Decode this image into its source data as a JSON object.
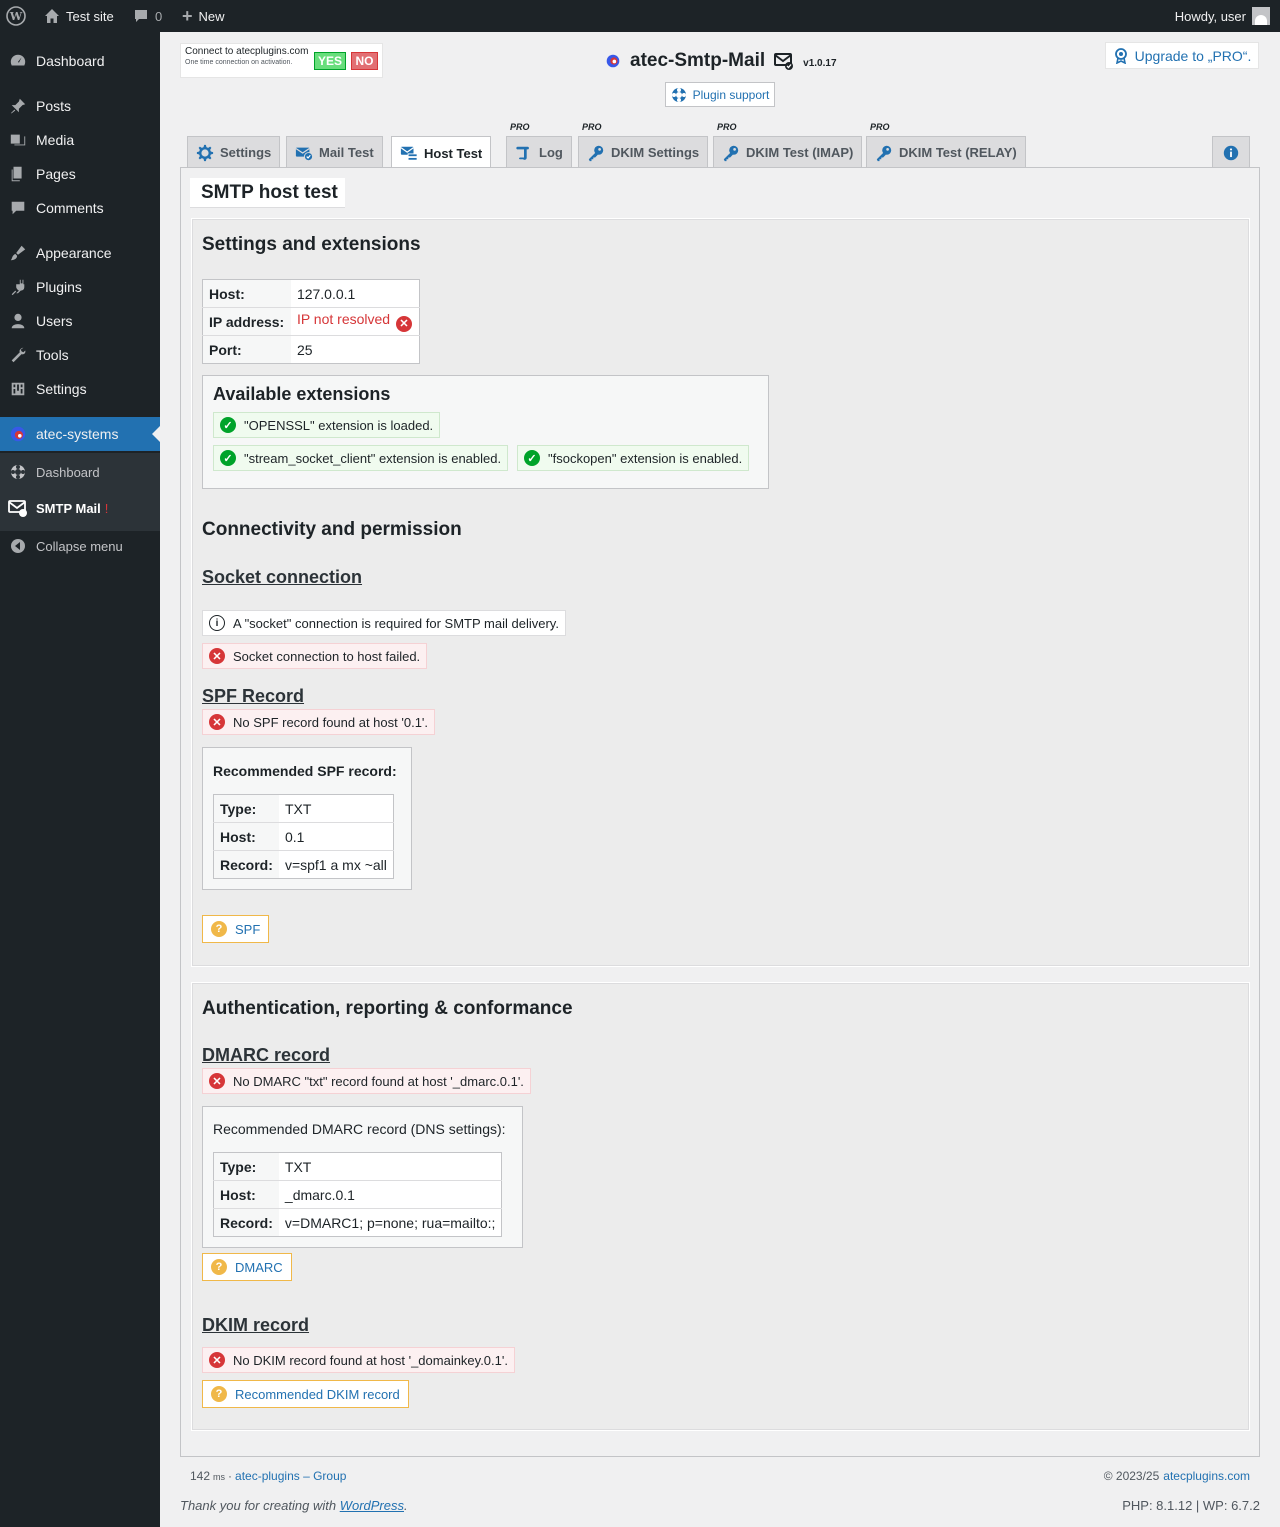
{
  "adminbar": {
    "site_name": "Test site",
    "comments_count": "0",
    "new_label": "New",
    "howdy": "Howdy, user"
  },
  "sidebar": {
    "items": [
      {
        "label": "Dashboard",
        "icon": "dashboard-icon"
      },
      {
        "label": "Posts",
        "icon": "pin-icon"
      },
      {
        "label": "Media",
        "icon": "media-icon"
      },
      {
        "label": "Pages",
        "icon": "pages-icon"
      },
      {
        "label": "Comments",
        "icon": "comments-icon"
      },
      {
        "label": "Appearance",
        "icon": "brush-icon"
      },
      {
        "label": "Plugins",
        "icon": "plug-icon"
      },
      {
        "label": "Users",
        "icon": "users-icon"
      },
      {
        "label": "Tools",
        "icon": "wrench-icon"
      },
      {
        "label": "Settings",
        "icon": "settings-icon"
      },
      {
        "label": "atec-systems",
        "icon": "atec-logo-icon"
      }
    ],
    "submenu": [
      {
        "label": "Dashboard"
      },
      {
        "label": "SMTP Mail",
        "marker": "!"
      }
    ],
    "collapse": "Collapse menu"
  },
  "header": {
    "connect_title": "Connect to atecplugins.com",
    "connect_sub": "One time connection on activation.",
    "yes": "YES",
    "no": "NO",
    "plugin_title": "atec-Smtp-Mail",
    "version": "v1.0.17",
    "plugin_support": "Plugin support",
    "upgrade": "Upgrade to „PRO“."
  },
  "tabs": [
    {
      "label": "Settings",
      "pro": ""
    },
    {
      "label": "Mail Test",
      "pro": ""
    },
    {
      "label": "Host Test",
      "pro": ""
    },
    {
      "label": "Log",
      "pro": "PRO"
    },
    {
      "label": "DKIM Settings",
      "pro": "PRO"
    },
    {
      "label": "DKIM Test (IMAP)",
      "pro": "PRO"
    },
    {
      "label": "DKIM Test (RELAY)",
      "pro": "PRO"
    }
  ],
  "page_title": "SMTP host test",
  "settings": {
    "heading": "Settings and extensions",
    "host_label": "Host:",
    "host_value": "127.0.0.1",
    "ip_label": "IP address:",
    "ip_value": "IP not resolved",
    "port_label": "Port:",
    "port_value": "25",
    "ext_heading": "Available extensions",
    "ext": [
      "\"OPENSSL\" extension is loaded.",
      "\"stream_socket_client\" extension is enabled.",
      "\"fsockopen\" extension is enabled."
    ]
  },
  "connectivity": {
    "heading": "Connectivity and permission",
    "socket_heading": "Socket connection",
    "socket_info": "A \"socket\" connection is required for SMTP mail delivery.",
    "socket_error": "Socket connection to host failed.",
    "spf_heading": "SPF Record",
    "spf_error": "No SPF record found at host '0.1'.",
    "spf_rec_heading": "Recommended SPF record:",
    "spf_type_label": "Type:",
    "spf_type": "TXT",
    "spf_host_label": "Host:",
    "spf_host": "0.1",
    "spf_record_label": "Record:",
    "spf_record": "v=spf1 a mx ~all",
    "spf_help": "SPF"
  },
  "auth": {
    "heading": "Authentication, reporting & conformance",
    "dmarc_heading": "DMARC record",
    "dmarc_error": "No DMARC \"txt\" record found at host '_dmarc.0.1'.",
    "dmarc_rec_heading": "Recommended DMARC record (DNS settings):",
    "dmarc_type_label": "Type:",
    "dmarc_type": "TXT",
    "dmarc_host_label": "Host:",
    "dmarc_host": "_dmarc.0.1",
    "dmarc_record_label": "Record:",
    "dmarc_record": "v=DMARC1; p=none; rua=mailto:;",
    "dmarc_help": "DMARC",
    "dkim_heading": "DKIM record",
    "dkim_error": "No DKIM record found at host '_domainkey.0.1'.",
    "dkim_help": "Recommended DKIM record"
  },
  "footer": {
    "ms_value": "142",
    "ms_unit": "ms",
    "group_link": "atec-plugins – Group",
    "copyright": "© 2023/25",
    "site_link": "atecplugins.com",
    "thanks_prefix": "Thank you for creating with",
    "wp_link": "WordPress",
    "versions": "PHP: 8.1.12 | WP: 6.7.2"
  }
}
